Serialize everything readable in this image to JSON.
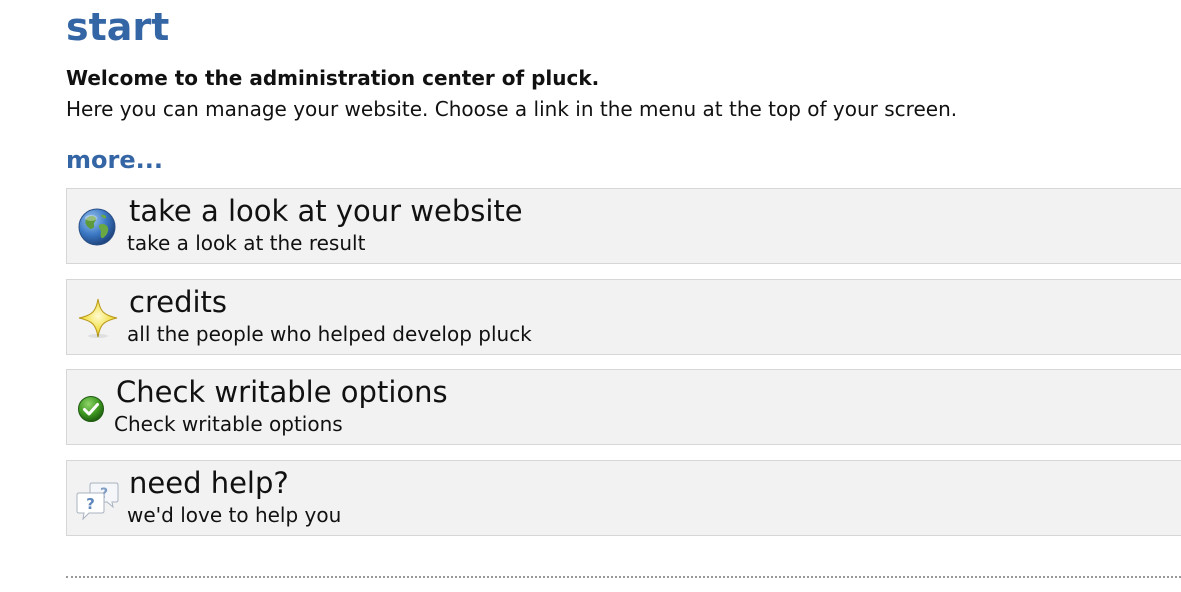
{
  "page": {
    "title": "start",
    "welcome_strong": "Welcome to the administration center of pluck.",
    "welcome_text": "Here you can manage your website. Choose a link in the menu at the top of your screen.",
    "more_link": "more..."
  },
  "menu": {
    "items": [
      {
        "title": "take a look at your website",
        "subtitle": "take a look at the result",
        "icon": "globe-icon"
      },
      {
        "title": "credits",
        "subtitle": "all the people who helped develop pluck",
        "icon": "star-icon"
      },
      {
        "title": "Check writable options",
        "subtitle": "Check writable options",
        "icon": "checkmark-icon"
      },
      {
        "title": "need help?",
        "subtitle": "we'd love to help you",
        "icon": "help-bubbles-icon"
      }
    ]
  },
  "colors": {
    "accent": "#3465a4",
    "box_background": "#f2f2f2",
    "box_border": "#d6d6d6"
  }
}
